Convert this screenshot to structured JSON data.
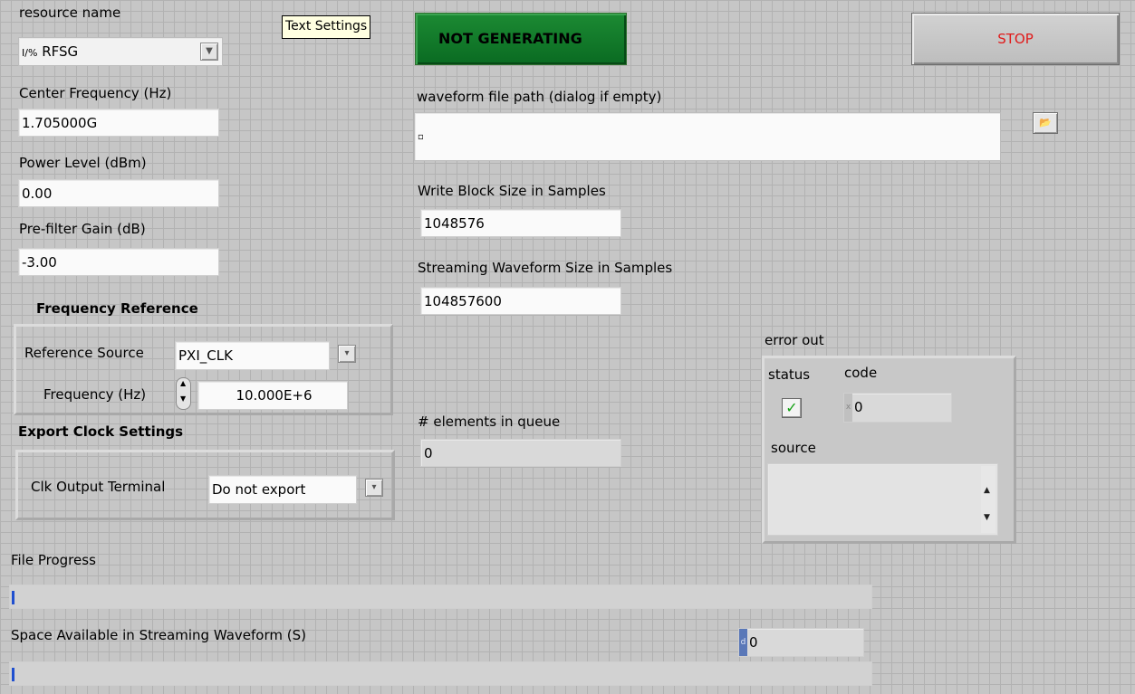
{
  "resource": {
    "label": "resource name",
    "prefix": "I/%",
    "value": "RFSG"
  },
  "text_settings": "Text Settings",
  "status_led": "NOT GENERATING",
  "stop_button": "STOP",
  "center_frequency": {
    "label": "Center Frequency (Hz)",
    "value": "1.705000G"
  },
  "power_level": {
    "label": "Power Level (dBm)",
    "value": "0.00"
  },
  "prefilter_gain": {
    "label": "Pre-filter Gain (dB)",
    "value": "-3.00"
  },
  "waveform_path": {
    "label": "waveform file path (dialog if empty)",
    "value": ""
  },
  "write_block": {
    "label": "Write Block Size in Samples",
    "value": "1048576"
  },
  "streaming_size": {
    "label": "Streaming Waveform Size in Samples",
    "value": "104857600"
  },
  "freq_ref": {
    "title": "Frequency Reference",
    "source_label": "Reference Source",
    "source_value": "PXI_CLK",
    "freq_label": "Frequency (Hz)",
    "freq_value": "10.000E+6"
  },
  "export_clock": {
    "title": "Export Clock Settings",
    "terminal_label": "Clk Output Terminal",
    "terminal_value": "Do not export"
  },
  "queue": {
    "label": "# elements in queue",
    "value": "0"
  },
  "error_out": {
    "title": "error out",
    "status_label": "status",
    "code_label": "code",
    "code_value": "0",
    "source_label": "source",
    "source_value": ""
  },
  "file_progress": {
    "label": "File Progress",
    "progress": 0.005
  },
  "space_available": {
    "label": "Space Available in Streaming Waveform (S)",
    "value": "0",
    "progress": 0.005
  },
  "colors": {
    "led_green": "#0a6b22",
    "stop_red": "#e01a1a",
    "progress_blue": "#1f4fcf"
  }
}
